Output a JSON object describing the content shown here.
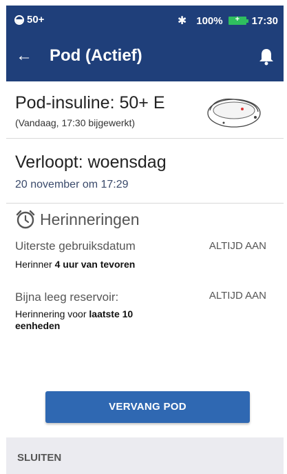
{
  "statusbar": {
    "notification_count": "50+",
    "bluetooth_icon": "bluetooth-icon",
    "battery_percent": "100%",
    "time": "17:30"
  },
  "appbar": {
    "back_icon": "arrow-left-icon",
    "title": "Pod (Actief)",
    "bell_icon": "bell-icon"
  },
  "pod": {
    "insulin_title": "Pod-insuline: 50+ E",
    "updated": "(Vandaag, 17:30 bijgewerkt)"
  },
  "expiry": {
    "title": "Verloopt: woensdag",
    "date": "20 november om 17:29"
  },
  "reminders": {
    "header": "Herinneringen",
    "items": [
      {
        "label": "Uiterste gebruiksdatum",
        "status": "ALTIJD AAN",
        "note_prefix": "Herinner ",
        "note_bold": "4 uur van tevoren",
        "note_suffix": ""
      },
      {
        "label": "Bijna leeg reservoir:",
        "status": "ALTIJD AAN",
        "note_prefix": "Herinnering voor ",
        "note_bold": "laatste 10 eenheden",
        "note_suffix": ""
      }
    ]
  },
  "actions": {
    "replace_pod": "VERVANG POD",
    "close": "SLUITEN"
  },
  "colors": {
    "header_bg": "#1f3f7a",
    "button_bg": "#2f68b2",
    "footer_bg": "#ebebf0"
  }
}
